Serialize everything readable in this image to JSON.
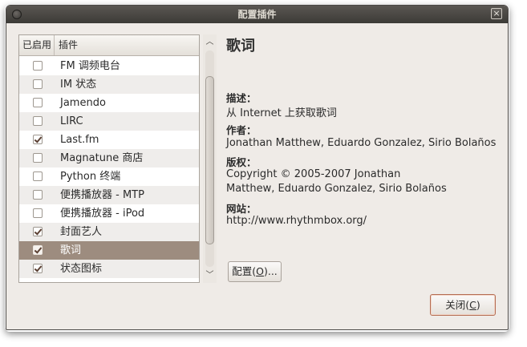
{
  "window": {
    "title": "配置插件",
    "close_glyph": "×"
  },
  "plugins": {
    "header_enabled": "已启用",
    "header_name": "插件",
    "rows": [
      {
        "name": "FM 调频电台",
        "enabled": false,
        "selected": false
      },
      {
        "name": "IM 状态",
        "enabled": false,
        "selected": false
      },
      {
        "name": "Jamendo",
        "enabled": false,
        "selected": false
      },
      {
        "name": "LIRC",
        "enabled": false,
        "selected": false
      },
      {
        "name": "Last.fm",
        "enabled": true,
        "selected": false
      },
      {
        "name": "Magnatune 商店",
        "enabled": false,
        "selected": false
      },
      {
        "name": "Python 终端",
        "enabled": false,
        "selected": false
      },
      {
        "name": "便携播放器 - MTP",
        "enabled": false,
        "selected": false
      },
      {
        "name": "便携播放器 - iPod",
        "enabled": false,
        "selected": false
      },
      {
        "name": "封面艺人",
        "enabled": true,
        "selected": false
      },
      {
        "name": "歌词",
        "enabled": true,
        "selected": true
      },
      {
        "name": "状态图标",
        "enabled": true,
        "selected": false
      }
    ],
    "scroll_up_icon": "chevron-up-icon",
    "scroll_down_icon": "chevron-down-icon"
  },
  "details": {
    "title": "歌词",
    "description_label": "描述：",
    "description_value": "从 Internet 上获取歌词",
    "author_label": "作者：",
    "author_value": "Jonathan Matthew, Eduardo Gonzalez, Sirio Bolaños",
    "copyright_label": "版权：",
    "copyright_line1": "Copyright © 2005-2007 Jonathan",
    "copyright_line2": "Matthew, Eduardo Gonzalez, Sirio Bolaños",
    "website_label": "网站：",
    "website_value": "http://www.rhythmbox.org/"
  },
  "buttons": {
    "configure_label": "配置",
    "configure_mnemonic": "O",
    "configure_suffix": "...",
    "close_label": "关闭",
    "close_mnemonic": "C"
  },
  "colors": {
    "selection": "#9d8c7f",
    "titlebar": "#3c3b37",
    "window_bg": "#efebe7",
    "default_button_border": "#b56d53"
  }
}
